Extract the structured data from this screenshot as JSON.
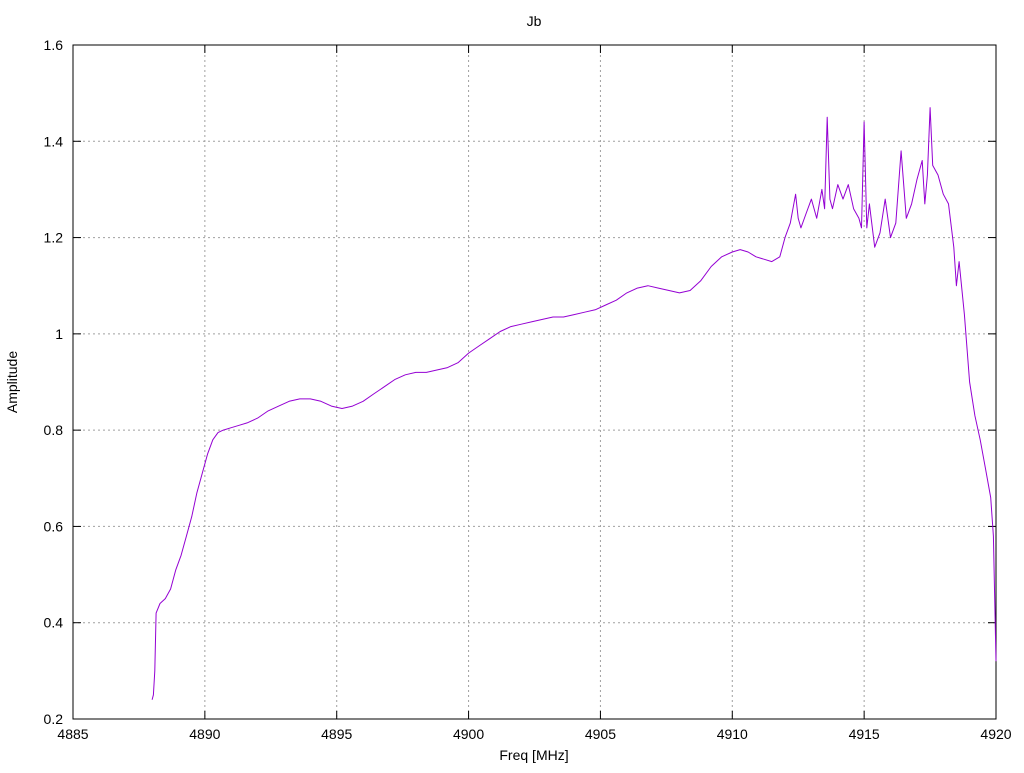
{
  "chart_data": {
    "type": "line",
    "title": "Jb",
    "xlabel": "Freq [MHz]",
    "ylabel": "Amplitude",
    "xlim": [
      4885,
      4920
    ],
    "ylim": [
      0.2,
      1.6
    ],
    "grid": true,
    "xticks": [
      4885,
      4890,
      4895,
      4900,
      4905,
      4910,
      4915,
      4920
    ],
    "yticks": [
      0.2,
      0.4,
      0.6,
      0.8,
      1.0,
      1.2,
      1.4,
      1.6
    ],
    "xtick_labels": [
      "4885",
      "4890",
      "4895",
      "4900",
      "4905",
      "4910",
      "4915",
      "4920"
    ],
    "ytick_labels": [
      "0.2",
      "0.4",
      "0.6",
      "0.8",
      "1",
      "1.2",
      "1.4",
      "1.6"
    ],
    "series": [
      {
        "color": "#9400d3",
        "x": [
          4888.0,
          4888.05,
          4888.1,
          4888.15,
          4888.3,
          4888.5,
          4888.7,
          4888.9,
          4889.1,
          4889.3,
          4889.5,
          4889.7,
          4889.9,
          4890.1,
          4890.3,
          4890.5,
          4890.7,
          4891.0,
          4891.3,
          4891.6,
          4892.0,
          4892.4,
          4892.8,
          4893.2,
          4893.6,
          4894.0,
          4894.4,
          4894.8,
          4895.2,
          4895.6,
          4896.0,
          4896.4,
          4896.8,
          4897.2,
          4897.6,
          4898.0,
          4898.4,
          4898.8,
          4899.2,
          4899.6,
          4900.0,
          4900.4,
          4900.8,
          4901.2,
          4901.6,
          4902.0,
          4902.4,
          4902.8,
          4903.2,
          4903.6,
          4904.0,
          4904.4,
          4904.8,
          4905.2,
          4905.6,
          4906.0,
          4906.4,
          4906.8,
          4907.2,
          4907.6,
          4908.0,
          4908.4,
          4908.8,
          4909.2,
          4909.6,
          4910.0,
          4910.3,
          4910.6,
          4910.9,
          4911.2,
          4911.5,
          4911.8,
          4912.0,
          4912.2,
          4912.4,
          4912.5,
          4912.6,
          4912.8,
          4913.0,
          4913.2,
          4913.4,
          4913.5,
          4913.6,
          4913.7,
          4913.8,
          4914.0,
          4914.2,
          4914.4,
          4914.6,
          4914.8,
          4914.9,
          4915.0,
          4915.1,
          4915.2,
          4915.4,
          4915.6,
          4915.8,
          4916.0,
          4916.2,
          4916.4,
          4916.6,
          4916.8,
          4917.0,
          4917.2,
          4917.3,
          4917.4,
          4917.5,
          4917.6,
          4917.8,
          4918.0,
          4918.2,
          4918.4,
          4918.5,
          4918.6,
          4918.8,
          4919.0,
          4919.2,
          4919.4,
          4919.6,
          4919.8,
          4919.9,
          4920.0
        ],
        "y": [
          0.24,
          0.25,
          0.3,
          0.42,
          0.44,
          0.45,
          0.47,
          0.51,
          0.54,
          0.58,
          0.62,
          0.67,
          0.71,
          0.75,
          0.78,
          0.795,
          0.8,
          0.805,
          0.81,
          0.815,
          0.825,
          0.84,
          0.85,
          0.86,
          0.865,
          0.865,
          0.86,
          0.85,
          0.845,
          0.85,
          0.86,
          0.875,
          0.89,
          0.905,
          0.915,
          0.92,
          0.92,
          0.925,
          0.93,
          0.94,
          0.96,
          0.975,
          0.99,
          1.005,
          1.015,
          1.02,
          1.025,
          1.03,
          1.035,
          1.035,
          1.04,
          1.045,
          1.05,
          1.06,
          1.07,
          1.085,
          1.095,
          1.1,
          1.095,
          1.09,
          1.085,
          1.09,
          1.11,
          1.14,
          1.16,
          1.17,
          1.175,
          1.17,
          1.16,
          1.155,
          1.15,
          1.16,
          1.2,
          1.23,
          1.29,
          1.24,
          1.22,
          1.25,
          1.28,
          1.24,
          1.3,
          1.26,
          1.45,
          1.28,
          1.26,
          1.31,
          1.28,
          1.31,
          1.26,
          1.24,
          1.22,
          1.44,
          1.22,
          1.27,
          1.18,
          1.21,
          1.28,
          1.2,
          1.23,
          1.38,
          1.24,
          1.27,
          1.32,
          1.36,
          1.27,
          1.33,
          1.47,
          1.35,
          1.33,
          1.29,
          1.27,
          1.18,
          1.1,
          1.15,
          1.04,
          0.9,
          0.83,
          0.78,
          0.72,
          0.66,
          0.58,
          0.32
        ]
      }
    ]
  }
}
